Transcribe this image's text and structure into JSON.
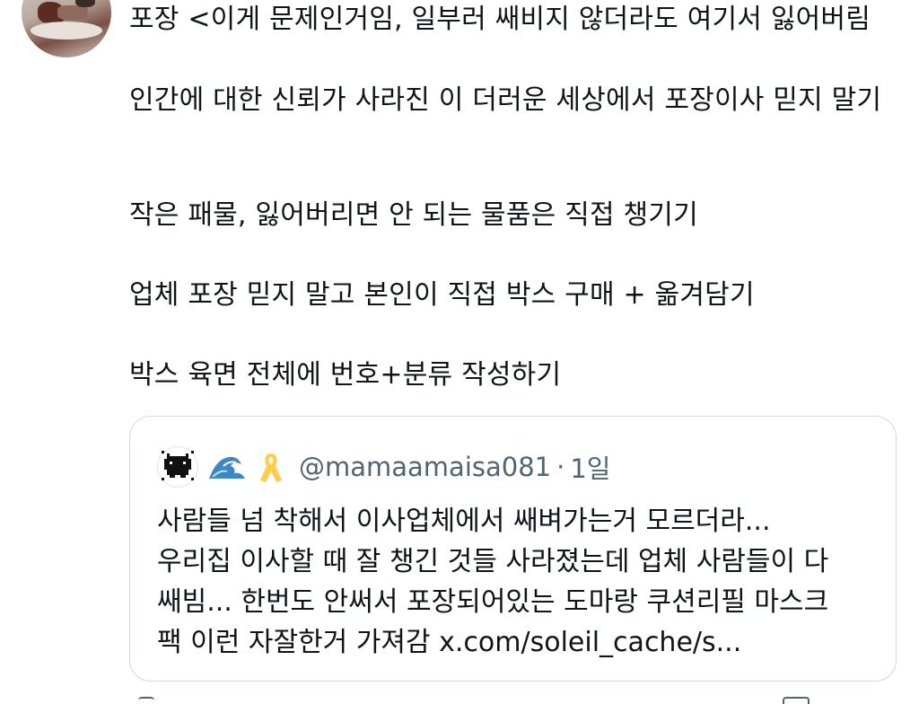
{
  "tweet": {
    "paragraphs": [
      "포장 <이게 문제인거임, 일부러 쌔비지 않더라도 여기서 잃어버림",
      "인간에 대한 신뢰가 사라진 이 더러운 세상에서 포장이사 믿지 말기",
      "작은 패물, 잃어버리면 안 되는 물품은 직접 챙기기",
      "업체 포장 믿지 말고 본인이 직접 박스 구매 + 옮겨담기",
      "박스 육면 전체에 번호+분류 작성하기"
    ]
  },
  "quoted_tweet": {
    "avatar_icon": "pixel-cat-icon",
    "name_emojis": [
      "wave-emoji",
      "yellow-ribbon-emoji"
    ],
    "handle": "@mamaamaisa081",
    "separator": "·",
    "time": "1일",
    "lines": [
      "사람들 넘 착해서 이사업체에서 쌔벼가는거 모르더라...",
      "우리집 이사할 때 잘 챙긴 것들 사라졌는데 업체 사람들이 다",
      "쌔빔... 한번도 안써서 포장되어있는 도마랑 쿠션리필 마스크",
      "팩 이런 자잘한거 가져감 x.com/soleil_cache/s..."
    ]
  },
  "colors": {
    "text": "#0f1419",
    "secondary": "#536471",
    "border": "#cfd9de"
  }
}
